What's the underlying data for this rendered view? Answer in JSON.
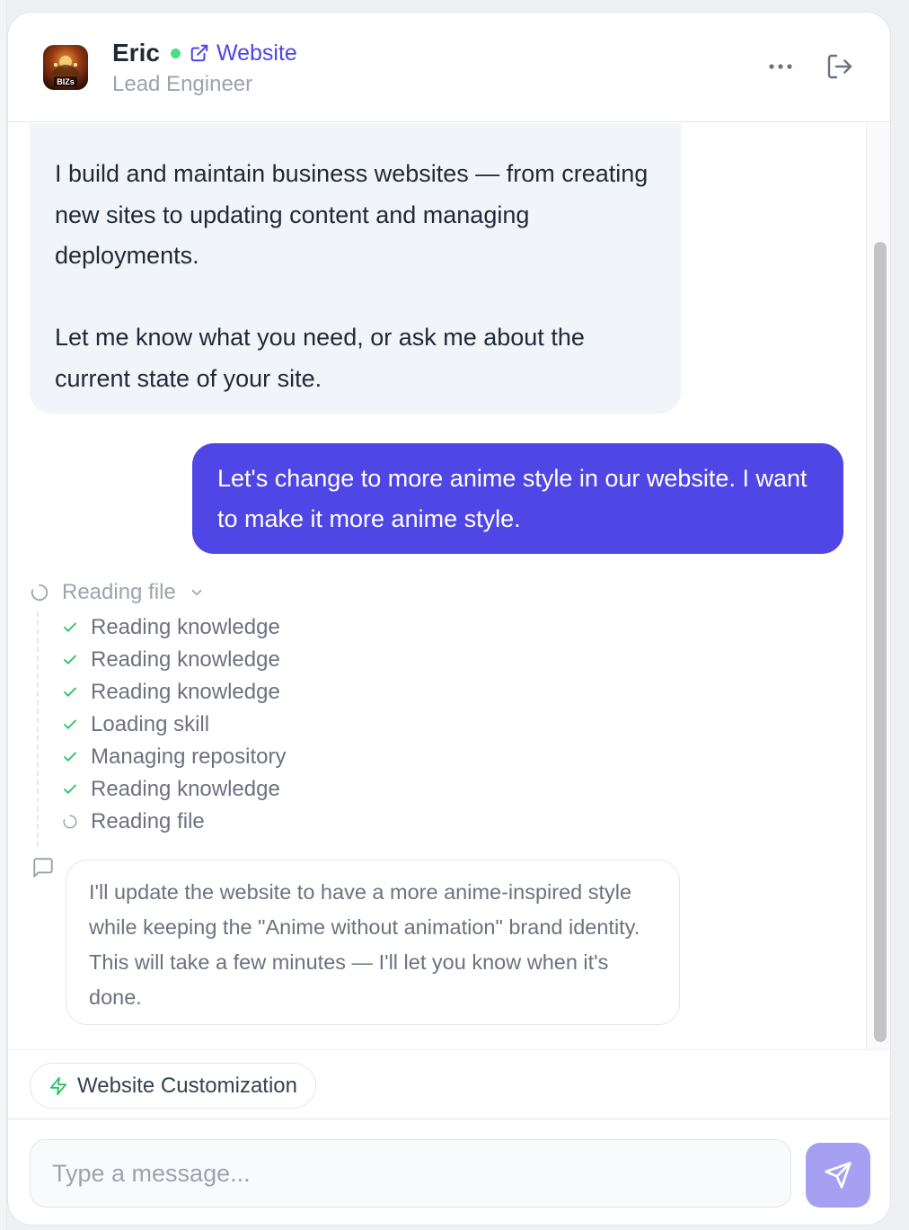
{
  "header": {
    "agent_name": "Eric",
    "website_label": "Website",
    "role": "Lead Engineer",
    "avatar_text": "BIZs"
  },
  "messages": {
    "agent_intro": [
      "I build and maintain business websites — from creating new sites to updating content and managing deployments.",
      "Let me know what you need, or ask me about the current state of your site."
    ],
    "user_message": "Let's change to more anime style in our website. I want to make it more anime style.",
    "activity": {
      "header_label": "Reading file",
      "steps": [
        {
          "label": "Reading knowledge",
          "status": "done"
        },
        {
          "label": "Reading knowledge",
          "status": "done"
        },
        {
          "label": "Reading knowledge",
          "status": "done"
        },
        {
          "label": "Loading skill",
          "status": "done"
        },
        {
          "label": "Managing repository",
          "status": "done"
        },
        {
          "label": "Reading knowledge",
          "status": "done"
        },
        {
          "label": "Reading file",
          "status": "in-progress"
        }
      ]
    },
    "agent_note": "I'll update the website to have a more anime-inspired style while keeping the \"Anime without animation\" brand identity. This will take a few minutes — I'll let you know when it's done."
  },
  "skill_chip": {
    "label": "Website Customization"
  },
  "composer": {
    "placeholder": "Type a message..."
  },
  "colors": {
    "accent": "#4f46e5",
    "online": "#4ade80",
    "done_check": "#22c55e",
    "send_button": "#a5a0f2"
  },
  "icons": {
    "website_link": "external-link-icon",
    "more": "more-horizontal-icon",
    "logout": "logout-icon",
    "step_done": "check-icon",
    "step_progress": "spinner-icon",
    "activity_header": "loading-circle-icon",
    "collapse": "chevron-down-icon",
    "note": "message-square-icon",
    "skill": "lightning-icon",
    "send": "send-icon"
  }
}
